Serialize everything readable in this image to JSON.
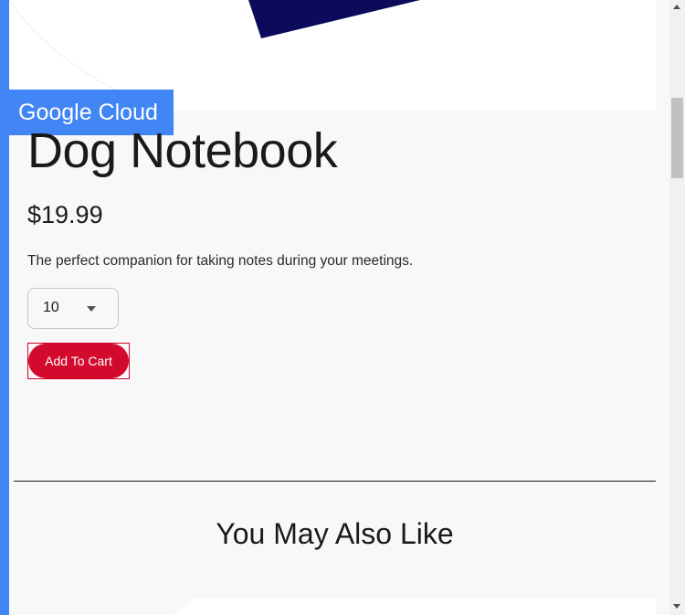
{
  "banner": {
    "label": "Google Cloud"
  },
  "product": {
    "title": "Dog Notebook",
    "price": "$19.99",
    "description": "The perfect companion for taking notes during your meetings.",
    "quantity": {
      "selected": "10"
    },
    "add_to_cart_label": "Add To Cart"
  },
  "recommendations": {
    "heading": "You May Also Like"
  },
  "colors": {
    "brand_blue": "#4285f4",
    "cart_red": "#d10a2e",
    "notebook_navy": "#0d0a5c"
  },
  "icons": {
    "quantity_caret": "caret-down-icon",
    "scroll_up": "scroll-up-arrow-icon",
    "scroll_down": "scroll-down-arrow-icon"
  }
}
